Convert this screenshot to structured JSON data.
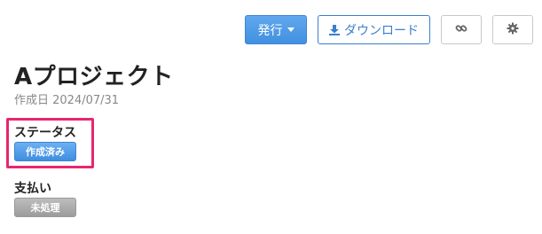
{
  "toolbar": {
    "publish_label": "発行",
    "download_label": "ダウンロード",
    "link_icon": "link-icon",
    "settings_icon": "gear-icon"
  },
  "project": {
    "title": "Aプロジェクト",
    "created": "作成日 2024/07/31"
  },
  "status": {
    "label": "ステータス",
    "value": "作成済み"
  },
  "payment": {
    "label": "支払い",
    "value": "未処理"
  },
  "colors": {
    "primary": "#4a9ae6",
    "highlight_border": "#e8266e",
    "badge_gray": "#a8a8a8"
  }
}
